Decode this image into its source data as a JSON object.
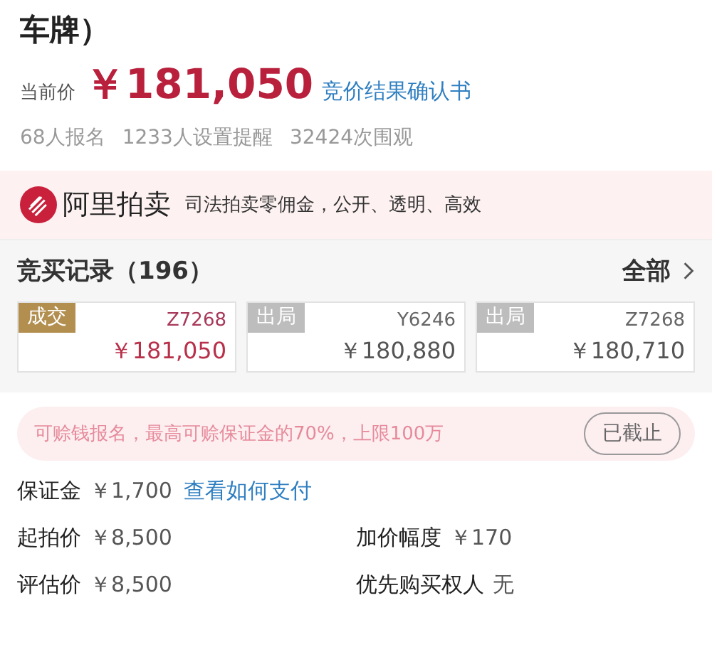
{
  "title": "车牌）",
  "price": {
    "label": "当前价",
    "amount": "￥181,050",
    "link": "竞价结果确认书"
  },
  "stats": [
    "68人报名",
    "1233人设置提醒",
    "32424次围观"
  ],
  "banner": {
    "brand": "阿里拍卖",
    "slogan": "司法拍卖零佣金，公开、透明、高效"
  },
  "records": {
    "title": "竞买记录（196）",
    "all": "全部",
    "items": [
      {
        "kind": "won",
        "status": "成交",
        "bidder": "Z7268",
        "amount": "￥181,050"
      },
      {
        "kind": "out",
        "status": "出局",
        "bidder": "Y6246",
        "amount": "￥180,880"
      },
      {
        "kind": "out",
        "status": "出局",
        "bidder": "Z7268",
        "amount": "￥180,710"
      }
    ]
  },
  "loan": {
    "text": "可赊钱报名，最高可赊保证金的70%，上限100万",
    "button": "已截止"
  },
  "deposit": {
    "label": "保证金",
    "amount": "￥1,700",
    "link": "查看如何支付"
  },
  "details": [
    {
      "label": "起拍价",
      "value": "￥8,500"
    },
    {
      "label": "加价幅度",
      "value": "￥170"
    },
    {
      "label": "评估价",
      "value": "￥8,500"
    },
    {
      "label": "优先购买权人",
      "value": "无"
    }
  ]
}
